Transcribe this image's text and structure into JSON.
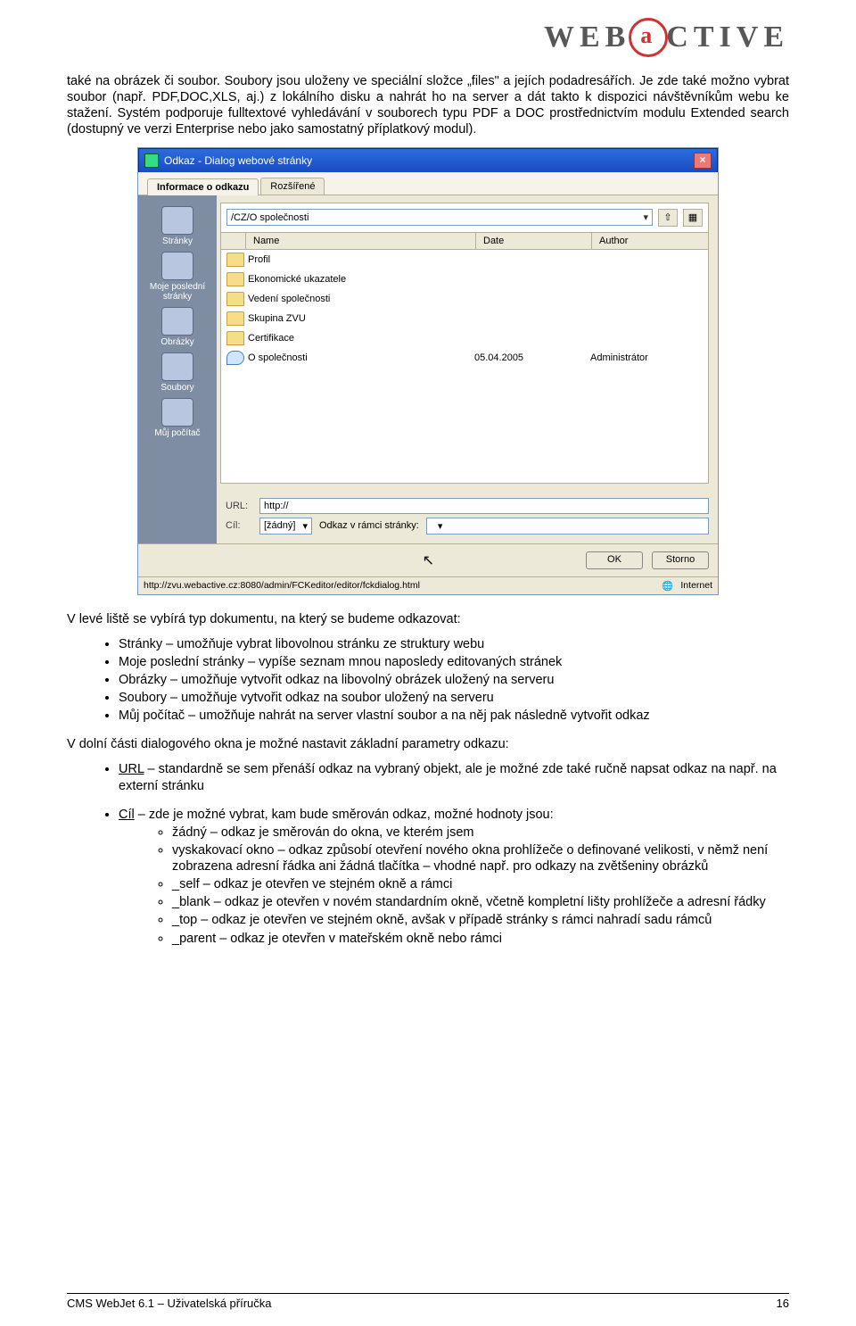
{
  "logo": {
    "left": "WEB",
    "right": "CTIVE"
  },
  "para1": "také na obrázek či soubor. Soubory jsou uloženy ve speciální složce „files\" a jejích podadresářích. Je zde také možno vybrat soubor (např. PDF,DOC,XLS, aj.) z lokálního disku a nahrát ho na server a dát takto k dispozici návštěvníkům webu ke stažení. Systém podporuje fulltextové vyhledávání v souborech typu PDF a DOC prostřednictvím modulu Extended search (dostupný ve verzi Enterprise nebo jako samostatný příplatkový modul).",
  "dialog": {
    "title": "Odkaz - Dialog webové stránky",
    "tabs": [
      "Informace o odkazu",
      "Rozšířené"
    ],
    "path": "/CZ/O společnosti",
    "sidebar": [
      "Stránky",
      "Moje poslední stránky",
      "Obrázky",
      "Soubory",
      "Můj počítač"
    ],
    "columns": [
      "Name",
      "Date",
      "Author"
    ],
    "rows": [
      {
        "icon": "folder",
        "name": "Profil",
        "date": "",
        "author": ""
      },
      {
        "icon": "folder",
        "name": "Ekonomické ukazatele",
        "date": "",
        "author": ""
      },
      {
        "icon": "folder",
        "name": "Vedení společnosti",
        "date": "",
        "author": ""
      },
      {
        "icon": "folder",
        "name": "Skupina ZVU",
        "date": "",
        "author": ""
      },
      {
        "icon": "folder",
        "name": "Certifikace",
        "date": "",
        "author": ""
      },
      {
        "icon": "page",
        "name": "O společnosti",
        "date": "05.04.2005",
        "author": "Administrátor"
      }
    ],
    "url_label": "URL:",
    "url_value": "http://",
    "target_label": "Cíl:",
    "target_value": "[žádný]",
    "anchor_label": "Odkaz v rámci stránky:",
    "anchor_value": "",
    "ok": "OK",
    "cancel": "Storno",
    "status_url": "http://zvu.webactive.cz:8080/admin/FCKeditor/editor/fckdialog.html",
    "status_zone": "Internet"
  },
  "para2": "V levé liště se vybírá typ dokumentu, na který se budeme odkazovat:",
  "list1": [
    "Stránky – umožňuje vybrat libovolnou stránku ze struktury webu",
    "Moje poslední stránky – vypíše seznam mnou naposledy editovaných stránek",
    "Obrázky – umožňuje vytvořit odkaz na libovolný obrázek uložený na serveru",
    "Soubory – umožňuje vytvořit odkaz na soubor uložený na serveru",
    "Můj počítač – umožňuje nahrát na server vlastní soubor a na něj pak následně vytvořit odkaz"
  ],
  "para3": "V dolní části dialogového okna je možné nastavit základní parametry odkazu:",
  "url_item": {
    "head": "URL",
    "text": " – standardně se sem přenáší odkaz na vybraný objekt, ale je možné zde také ručně napsat odkaz na např. na externí stránku"
  },
  "cil_item": {
    "head": "Cíl",
    "text": " – zde je možné vybrat, kam bude směrován odkaz, možné hodnoty jsou:"
  },
  "cil_sub": [
    "žádný – odkaz je směrován do okna, ve kterém jsem",
    "vyskakovací okno – odkaz způsobí otevření nového okna prohlížeče o definované velikosti, v němž není zobrazena adresní řádka ani žádná tlačítka – vhodné např. pro odkazy na zvětšeniny obrázků",
    "_self – odkaz je otevřen ve stejném okně a rámci",
    "_blank – odkaz je otevřen v novém standardním okně, včetně kompletní lišty prohlížeče a adresní řádky",
    "_top – odkaz je otevřen ve stejném okně, avšak v případě stránky s rámci nahradí sadu rámců",
    "_parent – odkaz je otevřen v mateřském okně nebo rámci"
  ],
  "footer": {
    "left": "CMS WebJet 6.1 – Uživatelská příručka",
    "right": "16"
  }
}
